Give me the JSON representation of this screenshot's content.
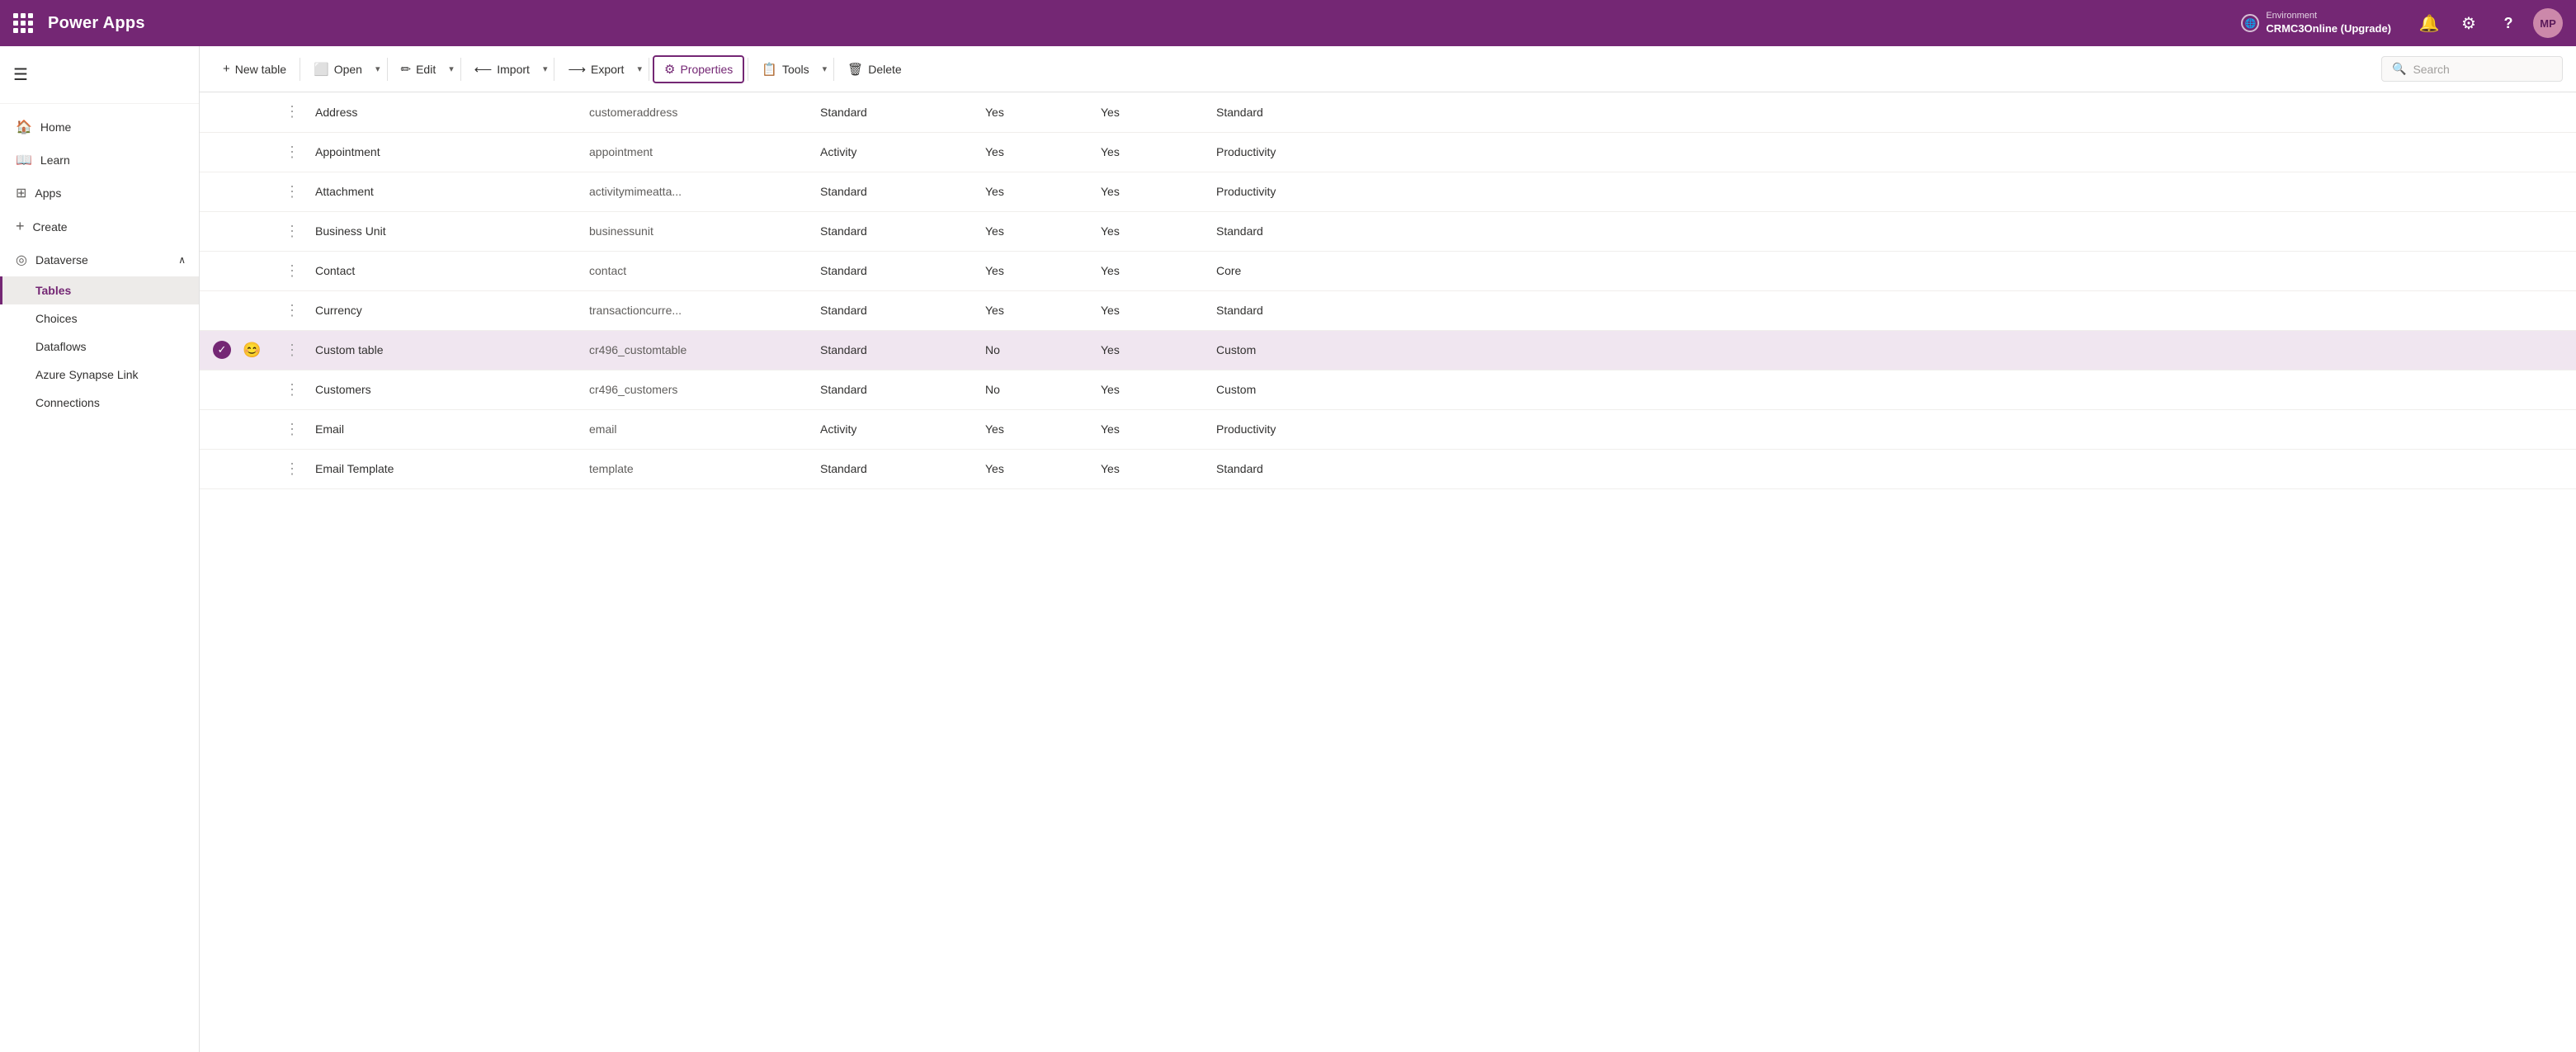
{
  "app": {
    "brand": "Power Apps",
    "grid_icon_label": "apps-grid"
  },
  "topnav": {
    "env_label": "Environment",
    "env_name": "CRMC3Online (Upgrade)",
    "bell_icon": "🔔",
    "gear_icon": "⚙",
    "help_icon": "?",
    "avatar_initials": "MP"
  },
  "sidebar": {
    "hamburger_label": "collapse-menu",
    "items": [
      {
        "id": "home",
        "label": "Home",
        "icon": "🏠",
        "active": false
      },
      {
        "id": "learn",
        "label": "Learn",
        "icon": "📖",
        "active": false
      },
      {
        "id": "apps",
        "label": "Apps",
        "icon": "⊞",
        "active": false
      },
      {
        "id": "create",
        "label": "Create",
        "icon": "+",
        "active": false
      },
      {
        "id": "dataverse",
        "label": "Dataverse",
        "icon": "◎",
        "active": false,
        "expanded": true,
        "chevron": "∧"
      }
    ],
    "sub_items": [
      {
        "id": "tables",
        "label": "Tables",
        "active": true
      },
      {
        "id": "choices",
        "label": "Choices",
        "active": false
      },
      {
        "id": "dataflows",
        "label": "Dataflows",
        "active": false
      },
      {
        "id": "azure-synapse-link",
        "label": "Azure Synapse Link",
        "active": false
      },
      {
        "id": "connections",
        "label": "Connections",
        "active": false
      }
    ]
  },
  "toolbar": {
    "new_table_label": "New table",
    "open_label": "Open",
    "edit_label": "Edit",
    "import_label": "Import",
    "export_label": "Export",
    "properties_label": "Properties",
    "tools_label": "Tools",
    "delete_label": "Delete",
    "search_placeholder": "Search"
  },
  "table": {
    "rows": [
      {
        "id": "address",
        "name": "Address",
        "logname": "customeraddress",
        "type": "Standard",
        "managed": "Yes",
        "customizable": "Yes",
        "solution": "Standard",
        "selected": false,
        "hasCheck": false,
        "hasEmoji": false
      },
      {
        "id": "appointment",
        "name": "Appointment",
        "logname": "appointment",
        "type": "Activity",
        "managed": "Yes",
        "customizable": "Yes",
        "solution": "Productivity",
        "selected": false,
        "hasCheck": false,
        "hasEmoji": false
      },
      {
        "id": "attachment",
        "name": "Attachment",
        "logname": "activitymimeatta...",
        "type": "Standard",
        "managed": "Yes",
        "customizable": "Yes",
        "solution": "Productivity",
        "selected": false,
        "hasCheck": false,
        "hasEmoji": false
      },
      {
        "id": "business-unit",
        "name": "Business Unit",
        "logname": "businessunit",
        "type": "Standard",
        "managed": "Yes",
        "customizable": "Yes",
        "solution": "Standard",
        "selected": false,
        "hasCheck": false,
        "hasEmoji": false
      },
      {
        "id": "contact",
        "name": "Contact",
        "logname": "contact",
        "type": "Standard",
        "managed": "Yes",
        "customizable": "Yes",
        "solution": "Core",
        "selected": false,
        "hasCheck": false,
        "hasEmoji": false
      },
      {
        "id": "currency",
        "name": "Currency",
        "logname": "transactioncurre...",
        "type": "Standard",
        "managed": "Yes",
        "customizable": "Yes",
        "solution": "Standard",
        "selected": false,
        "hasCheck": false,
        "hasEmoji": false
      },
      {
        "id": "custom-table",
        "name": "Custom table",
        "logname": "cr496_customtable",
        "type": "Standard",
        "managed": "No",
        "customizable": "Yes",
        "solution": "Custom",
        "selected": true,
        "hasCheck": true,
        "hasEmoji": true,
        "emoji": "😊"
      },
      {
        "id": "customers",
        "name": "Customers",
        "logname": "cr496_customers",
        "type": "Standard",
        "managed": "No",
        "customizable": "Yes",
        "solution": "Custom",
        "selected": false,
        "hasCheck": false,
        "hasEmoji": false
      },
      {
        "id": "email",
        "name": "Email",
        "logname": "email",
        "type": "Activity",
        "managed": "Yes",
        "customizable": "Yes",
        "solution": "Productivity",
        "selected": false,
        "hasCheck": false,
        "hasEmoji": false
      },
      {
        "id": "email-template",
        "name": "Email Template",
        "logname": "template",
        "type": "Standard",
        "managed": "Yes",
        "customizable": "Yes",
        "solution": "Standard",
        "selected": false,
        "hasCheck": false,
        "hasEmoji": false
      }
    ]
  }
}
